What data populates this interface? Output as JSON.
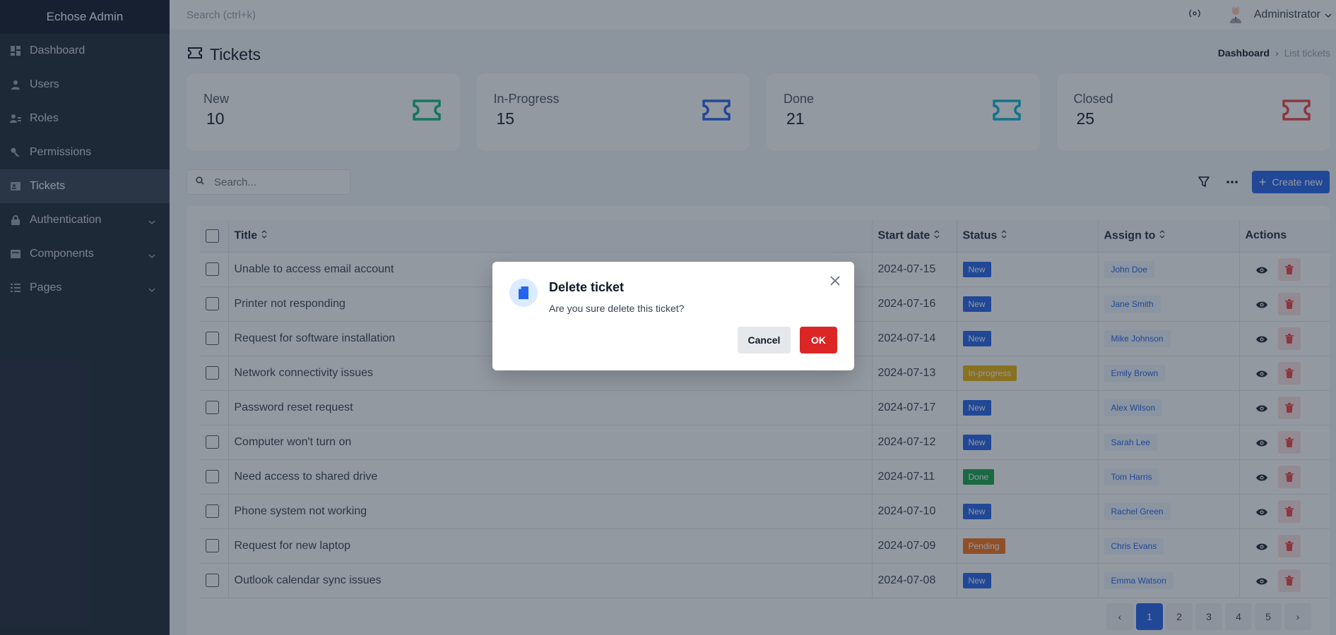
{
  "app": {
    "brand": "Echose Admin"
  },
  "topbar": {
    "search_placeholder": "Search (ctrl+k)",
    "user_name": "Administrator"
  },
  "sidebar": {
    "items": [
      {
        "label": "Dashboard",
        "icon": "dashboard-icon",
        "active": false,
        "expandable": false
      },
      {
        "label": "Users",
        "icon": "user-icon",
        "active": false,
        "expandable": false
      },
      {
        "label": "Roles",
        "icon": "roles-icon",
        "active": false,
        "expandable": false
      },
      {
        "label": "Permissions",
        "icon": "key-icon",
        "active": false,
        "expandable": false
      },
      {
        "label": "Tickets",
        "icon": "ticket-icon",
        "active": true,
        "expandable": false
      },
      {
        "label": "Authentication",
        "icon": "lock-icon",
        "active": false,
        "expandable": true
      },
      {
        "label": "Components",
        "icon": "components-icon",
        "active": false,
        "expandable": true
      },
      {
        "label": "Pages",
        "icon": "pages-icon",
        "active": false,
        "expandable": true
      }
    ]
  },
  "page": {
    "title": "Tickets",
    "breadcrumb": {
      "home": "Dashboard",
      "separator": "›",
      "current": "List tickets"
    }
  },
  "stats": [
    {
      "label": "New",
      "count": "10",
      "color": "#10b981"
    },
    {
      "label": "In-Progress",
      "count": "15",
      "color": "#2563eb"
    },
    {
      "label": "Done",
      "count": "21",
      "color": "#06b6d4"
    },
    {
      "label": "Closed",
      "count": "25",
      "color": "#ef4444"
    }
  ],
  "toolbar": {
    "search_placeholder": "Search...",
    "create_label": "Create new"
  },
  "table": {
    "columns": {
      "title": "Title",
      "start_date": "Start date",
      "status": "Status",
      "assign_to": "Assign to",
      "actions": "Actions"
    },
    "rows": [
      {
        "title": "Unable to access email account",
        "start_date": "2024-07-15",
        "status": "New",
        "status_color": "#2563eb",
        "assignee": "John Doe"
      },
      {
        "title": "Printer not responding",
        "start_date": "2024-07-16",
        "status": "New",
        "status_color": "#2563eb",
        "assignee": "Jane Smith"
      },
      {
        "title": "Request for software installation",
        "start_date": "2024-07-14",
        "status": "New",
        "status_color": "#2563eb",
        "assignee": "Mike Johnson"
      },
      {
        "title": "Network connectivity issues",
        "start_date": "2024-07-13",
        "status": "In-progress",
        "status_color": "#eab308",
        "assignee": "Emily Brown"
      },
      {
        "title": "Password reset request",
        "start_date": "2024-07-17",
        "status": "New",
        "status_color": "#2563eb",
        "assignee": "Alex Wilson"
      },
      {
        "title": "Computer won't turn on",
        "start_date": "2024-07-12",
        "status": "New",
        "status_color": "#2563eb",
        "assignee": "Sarah Lee"
      },
      {
        "title": "Need access to shared drive",
        "start_date": "2024-07-11",
        "status": "Done",
        "status_color": "#16a34a",
        "assignee": "Tom Harris"
      },
      {
        "title": "Phone system not working",
        "start_date": "2024-07-10",
        "status": "New",
        "status_color": "#2563eb",
        "assignee": "Rachel Green"
      },
      {
        "title": "Request for new laptop",
        "start_date": "2024-07-09",
        "status": "Pending",
        "status_color": "#f97316",
        "assignee": "Chris Evans"
      },
      {
        "title": "Outlook calendar sync issues",
        "start_date": "2024-07-08",
        "status": "New",
        "status_color": "#2563eb",
        "assignee": "Emma Watson"
      }
    ]
  },
  "pagination": {
    "prev": "‹",
    "pages": [
      "1",
      "2",
      "3",
      "4",
      "5"
    ],
    "active": "1",
    "next": "›"
  },
  "modal": {
    "title": "Delete ticket",
    "message": "Are you sure delete this ticket?",
    "cancel_label": "Cancel",
    "ok_label": "OK"
  }
}
